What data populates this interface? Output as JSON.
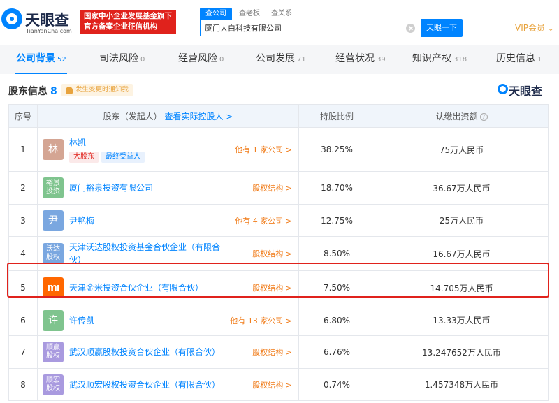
{
  "header": {
    "logo_cn": "天眼查",
    "logo_en": "TianYanCha.com",
    "banner_line1": "国家中小企业发展基金旗下",
    "banner_line2": "官方备案企业征信机构",
    "search_tabs": [
      "查公司",
      "查老板",
      "查关系"
    ],
    "search_value": "厦门大白科技有限公司",
    "search_button": "天眼一下",
    "vip_label": "VIP会员"
  },
  "nav": {
    "tabs": [
      {
        "label": "公司背景",
        "count": "52"
      },
      {
        "label": "司法风险",
        "count": "0"
      },
      {
        "label": "经营风险",
        "count": "0"
      },
      {
        "label": "公司发展",
        "count": "71"
      },
      {
        "label": "经营状况",
        "count": "39"
      },
      {
        "label": "知识产权",
        "count": "318"
      },
      {
        "label": "历史信息",
        "count": "1"
      }
    ]
  },
  "section": {
    "title": "股东信息",
    "count": "8",
    "notify": "发生变更时通知我",
    "watermark": "天眼查"
  },
  "table": {
    "headers": {
      "idx": "序号",
      "shareholder": "股东（发起人）",
      "shareholder_link": "查看实际控股人 >",
      "ratio": "持股比例",
      "amount": "认缴出资额"
    },
    "rows": [
      {
        "idx": "1",
        "avatar": "林",
        "avatar_color": "#d4a593",
        "name": "林凯",
        "tags": [
          "大股东",
          "最终受益人"
        ],
        "link": "他有 1 家公司 >",
        "ratio": "38.25%",
        "amount": "75万人民币"
      },
      {
        "idx": "2",
        "avatar": "裕景投资",
        "avatar_color": "#7fc48e",
        "name": "厦门裕泉投资有限公司",
        "link": "股权结构 >",
        "ratio": "18.70%",
        "amount": "36.67万人民币"
      },
      {
        "idx": "3",
        "avatar": "尹",
        "avatar_color": "#7aa7e0",
        "name": "尹艳梅",
        "link": "他有 4 家公司 >",
        "ratio": "12.75%",
        "amount": "25万人民币"
      },
      {
        "idx": "4",
        "avatar": "沃达股权",
        "avatar_color": "#7aa7e0",
        "name": "天津沃达股权投资基金合伙企业（有限合伙）",
        "link": "股权结构 >",
        "ratio": "8.50%",
        "amount": "16.67万人民币"
      },
      {
        "idx": "5",
        "avatar": "mi",
        "avatar_color": "#ff6700",
        "name": "天津金米投资合伙企业（有限合伙）",
        "link": "股权结构 >",
        "ratio": "7.50%",
        "amount": "14.705万人民币"
      },
      {
        "idx": "6",
        "avatar": "许",
        "avatar_color": "#7fc48e",
        "name": "许传凯",
        "link": "他有 13 家公司 >",
        "ratio": "6.80%",
        "amount": "13.33万人民币"
      },
      {
        "idx": "7",
        "avatar": "顺赢股权",
        "avatar_color": "#a99adf",
        "name": "武汉顺赢股权投资合伙企业（有限合伙）",
        "link": "股权结构 >",
        "ratio": "6.76%",
        "amount": "13.247652万人民币"
      },
      {
        "idx": "8",
        "avatar": "顺宏股权",
        "avatar_color": "#a99adf",
        "name": "武汉顺宏股权投资合伙企业（有限合伙）",
        "link": "股权结构 >",
        "ratio": "0.74%",
        "amount": "1.457348万人民币"
      }
    ]
  }
}
